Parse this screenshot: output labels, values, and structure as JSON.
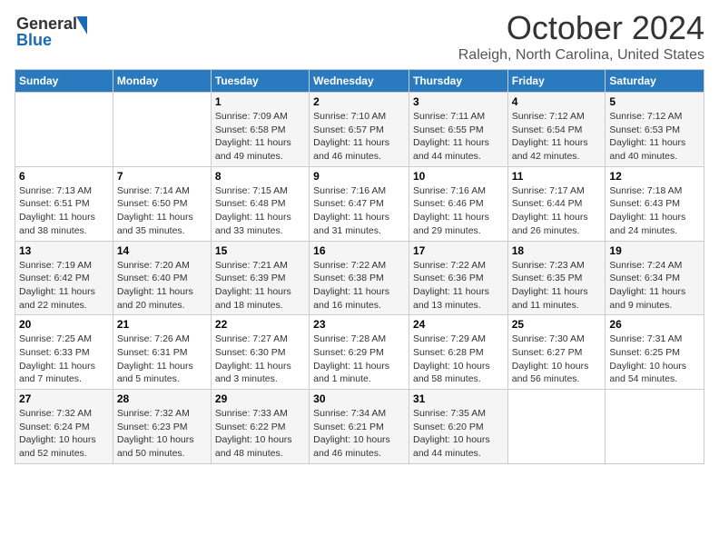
{
  "header": {
    "logo_line1": "General",
    "logo_line2": "Blue",
    "month_title": "October 2024",
    "location": "Raleigh, North Carolina, United States"
  },
  "days_of_week": [
    "Sunday",
    "Monday",
    "Tuesday",
    "Wednesday",
    "Thursday",
    "Friday",
    "Saturday"
  ],
  "weeks": [
    [
      {
        "day": "",
        "info": ""
      },
      {
        "day": "",
        "info": ""
      },
      {
        "day": "1",
        "info": "Sunrise: 7:09 AM\nSunset: 6:58 PM\nDaylight: 11 hours and 49 minutes."
      },
      {
        "day": "2",
        "info": "Sunrise: 7:10 AM\nSunset: 6:57 PM\nDaylight: 11 hours and 46 minutes."
      },
      {
        "day": "3",
        "info": "Sunrise: 7:11 AM\nSunset: 6:55 PM\nDaylight: 11 hours and 44 minutes."
      },
      {
        "day": "4",
        "info": "Sunrise: 7:12 AM\nSunset: 6:54 PM\nDaylight: 11 hours and 42 minutes."
      },
      {
        "day": "5",
        "info": "Sunrise: 7:12 AM\nSunset: 6:53 PM\nDaylight: 11 hours and 40 minutes."
      }
    ],
    [
      {
        "day": "6",
        "info": "Sunrise: 7:13 AM\nSunset: 6:51 PM\nDaylight: 11 hours and 38 minutes."
      },
      {
        "day": "7",
        "info": "Sunrise: 7:14 AM\nSunset: 6:50 PM\nDaylight: 11 hours and 35 minutes."
      },
      {
        "day": "8",
        "info": "Sunrise: 7:15 AM\nSunset: 6:48 PM\nDaylight: 11 hours and 33 minutes."
      },
      {
        "day": "9",
        "info": "Sunrise: 7:16 AM\nSunset: 6:47 PM\nDaylight: 11 hours and 31 minutes."
      },
      {
        "day": "10",
        "info": "Sunrise: 7:16 AM\nSunset: 6:46 PM\nDaylight: 11 hours and 29 minutes."
      },
      {
        "day": "11",
        "info": "Sunrise: 7:17 AM\nSunset: 6:44 PM\nDaylight: 11 hours and 26 minutes."
      },
      {
        "day": "12",
        "info": "Sunrise: 7:18 AM\nSunset: 6:43 PM\nDaylight: 11 hours and 24 minutes."
      }
    ],
    [
      {
        "day": "13",
        "info": "Sunrise: 7:19 AM\nSunset: 6:42 PM\nDaylight: 11 hours and 22 minutes."
      },
      {
        "day": "14",
        "info": "Sunrise: 7:20 AM\nSunset: 6:40 PM\nDaylight: 11 hours and 20 minutes."
      },
      {
        "day": "15",
        "info": "Sunrise: 7:21 AM\nSunset: 6:39 PM\nDaylight: 11 hours and 18 minutes."
      },
      {
        "day": "16",
        "info": "Sunrise: 7:22 AM\nSunset: 6:38 PM\nDaylight: 11 hours and 16 minutes."
      },
      {
        "day": "17",
        "info": "Sunrise: 7:22 AM\nSunset: 6:36 PM\nDaylight: 11 hours and 13 minutes."
      },
      {
        "day": "18",
        "info": "Sunrise: 7:23 AM\nSunset: 6:35 PM\nDaylight: 11 hours and 11 minutes."
      },
      {
        "day": "19",
        "info": "Sunrise: 7:24 AM\nSunset: 6:34 PM\nDaylight: 11 hours and 9 minutes."
      }
    ],
    [
      {
        "day": "20",
        "info": "Sunrise: 7:25 AM\nSunset: 6:33 PM\nDaylight: 11 hours and 7 minutes."
      },
      {
        "day": "21",
        "info": "Sunrise: 7:26 AM\nSunset: 6:31 PM\nDaylight: 11 hours and 5 minutes."
      },
      {
        "day": "22",
        "info": "Sunrise: 7:27 AM\nSunset: 6:30 PM\nDaylight: 11 hours and 3 minutes."
      },
      {
        "day": "23",
        "info": "Sunrise: 7:28 AM\nSunset: 6:29 PM\nDaylight: 11 hours and 1 minute."
      },
      {
        "day": "24",
        "info": "Sunrise: 7:29 AM\nSunset: 6:28 PM\nDaylight: 10 hours and 58 minutes."
      },
      {
        "day": "25",
        "info": "Sunrise: 7:30 AM\nSunset: 6:27 PM\nDaylight: 10 hours and 56 minutes."
      },
      {
        "day": "26",
        "info": "Sunrise: 7:31 AM\nSunset: 6:25 PM\nDaylight: 10 hours and 54 minutes."
      }
    ],
    [
      {
        "day": "27",
        "info": "Sunrise: 7:32 AM\nSunset: 6:24 PM\nDaylight: 10 hours and 52 minutes."
      },
      {
        "day": "28",
        "info": "Sunrise: 7:32 AM\nSunset: 6:23 PM\nDaylight: 10 hours and 50 minutes."
      },
      {
        "day": "29",
        "info": "Sunrise: 7:33 AM\nSunset: 6:22 PM\nDaylight: 10 hours and 48 minutes."
      },
      {
        "day": "30",
        "info": "Sunrise: 7:34 AM\nSunset: 6:21 PM\nDaylight: 10 hours and 46 minutes."
      },
      {
        "day": "31",
        "info": "Sunrise: 7:35 AM\nSunset: 6:20 PM\nDaylight: 10 hours and 44 minutes."
      },
      {
        "day": "",
        "info": ""
      },
      {
        "day": "",
        "info": ""
      }
    ]
  ]
}
